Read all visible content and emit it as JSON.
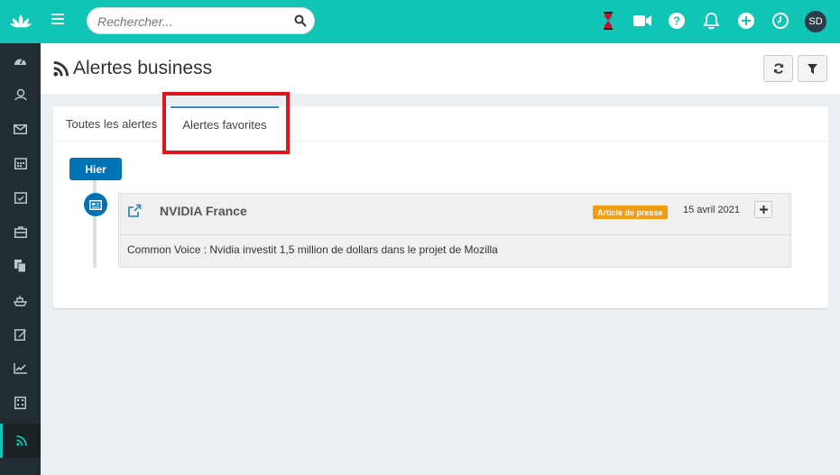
{
  "topbar": {
    "search": {
      "placeholder": "Rechercher..."
    },
    "avatar_initials": "SD",
    "icons": [
      "hourglass-icon",
      "video-icon",
      "help-icon",
      "bell-icon",
      "plus-circle-icon",
      "clock-icon"
    ],
    "colors": {
      "primary": "#10c5b5",
      "sidebar": "#222d32",
      "accent_blue": "#0073b7",
      "badge_orange": "#f39c12"
    }
  },
  "sidebar": {
    "items": [
      {
        "icon": "dashboard-icon"
      },
      {
        "icon": "contacts-icon"
      },
      {
        "icon": "mail-icon"
      },
      {
        "icon": "calendar-icon"
      },
      {
        "icon": "calendar-check-icon"
      },
      {
        "icon": "briefcase-icon"
      },
      {
        "icon": "documents-icon"
      },
      {
        "icon": "boat-icon"
      },
      {
        "icon": "edit-icon"
      },
      {
        "icon": "chart-icon"
      },
      {
        "icon": "calculator-icon"
      },
      {
        "icon": "rss-icon",
        "active": true
      }
    ]
  },
  "header": {
    "title": "Alertes business",
    "buttons": [
      "refresh-icon",
      "filter-icon"
    ]
  },
  "tabs": [
    {
      "label": "Toutes les alertes",
      "active": false
    },
    {
      "label": "Alertes favorites",
      "active": true
    }
  ],
  "timeline": {
    "time_label": "Hier",
    "items": [
      {
        "title": "NVIDIA France",
        "badge": "Article de presse",
        "date": "15 avril 2021",
        "body": "Common Voice : Nvidia investit 1,5 million de dollars dans le projet de Mozilla"
      }
    ]
  }
}
